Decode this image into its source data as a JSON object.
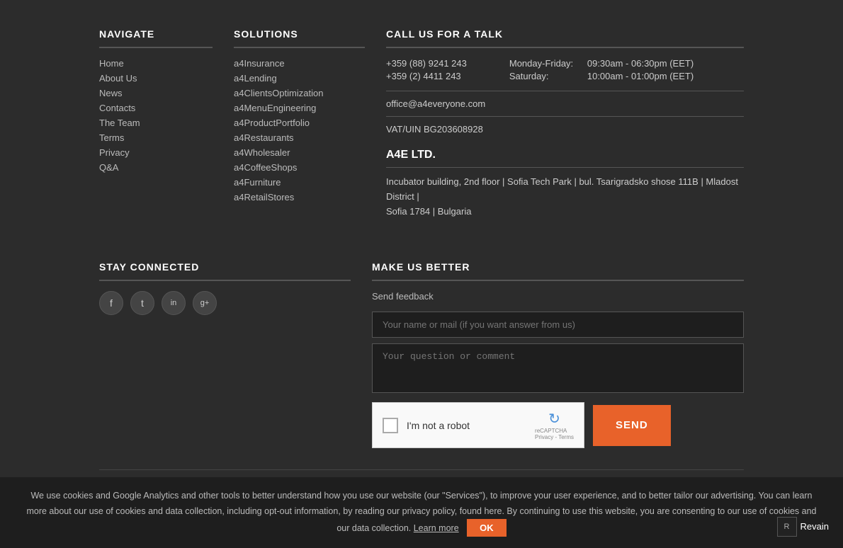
{
  "navigate": {
    "title": "NAVIGATE",
    "links": [
      {
        "label": "Home",
        "href": "#"
      },
      {
        "label": "About Us",
        "href": "#"
      },
      {
        "label": "News",
        "href": "#"
      },
      {
        "label": "Contacts",
        "href": "#"
      },
      {
        "label": "The Team",
        "href": "#"
      },
      {
        "label": "Terms",
        "href": "#"
      },
      {
        "label": "Privacy",
        "href": "#"
      },
      {
        "label": "Q&A",
        "href": "#"
      }
    ]
  },
  "solutions": {
    "title": "SOLUTIONS",
    "links": [
      {
        "label": "a4Insurance",
        "href": "#"
      },
      {
        "label": "a4Lending",
        "href": "#"
      },
      {
        "label": "a4ClientsOptimization",
        "href": "#"
      },
      {
        "label": "a4MenuEngineering",
        "href": "#"
      },
      {
        "label": "a4ProductPortfolio",
        "href": "#"
      },
      {
        "label": "a4Restaurants",
        "href": "#"
      },
      {
        "label": "a4Wholesaler",
        "href": "#"
      },
      {
        "label": "a4CoffeeShops",
        "href": "#"
      },
      {
        "label": "a4Furniture",
        "href": "#"
      },
      {
        "label": "a4RetailStores",
        "href": "#"
      }
    ]
  },
  "call": {
    "title": "CALL US FOR A TALK",
    "phones": [
      "+359 (88) 9241 243",
      "+359 (2) 4411 243"
    ],
    "hours": [
      {
        "day": "Monday-Friday:",
        "time": "09:30am - 06:30pm (EET)"
      },
      {
        "day": "Saturday:",
        "time": "10:00am - 01:00pm (EET)"
      }
    ],
    "email": "office@a4everyone.com",
    "vat": "VAT/UIN BG203608928"
  },
  "company": {
    "name": "A4E LTD.",
    "address": "Incubator building, 2nd floor | Sofia Tech Park | bul. Tsarigradsko shose 111B | Mladost District | Sofia 1784 | Bulgaria"
  },
  "stay_connected": {
    "title": "STAY CONNECTED",
    "socials": [
      {
        "name": "facebook",
        "icon": "f"
      },
      {
        "name": "twitter",
        "icon": "t"
      },
      {
        "name": "linkedin",
        "icon": "in"
      },
      {
        "name": "google-plus",
        "icon": "g+"
      }
    ]
  },
  "feedback": {
    "title": "MAKE US BETTER",
    "description": "Send feedback",
    "name_placeholder": "Your name or mail (if you want answer from us)",
    "comment_placeholder": "Your question or comment",
    "send_label": "SEND",
    "captcha_label": "I'm not a robot",
    "ok_label": "OK"
  },
  "cookie": {
    "text": "We use cookies and Google Analytics and other tools to better understand how you use our website (our \"Services\"), to improve your user experience, and to better tailor our advertising. You can learn more about our use of cookies and data collection, including opt-out information, by reading our privacy policy, found here. By continuing to use this website, you are consenting to our use of cookies and our data collection.",
    "learn_more": "Learn more"
  }
}
